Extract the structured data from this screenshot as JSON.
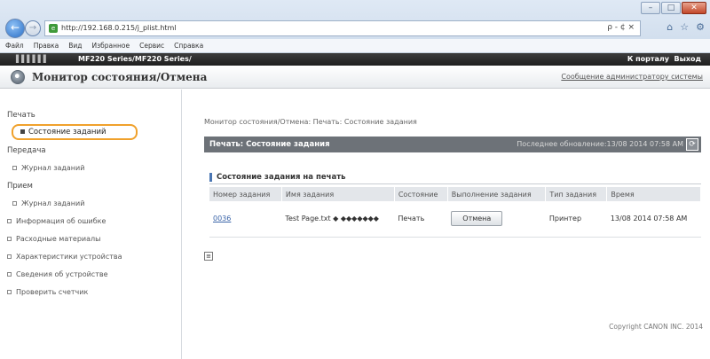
{
  "browser": {
    "url": "http://192.168.0.215/j_plist.html",
    "address_tools": "ρ - ¢ ×",
    "menu": [
      "Файл",
      "Правка",
      "Вид",
      "Избранное",
      "Сервис",
      "Справка"
    ]
  },
  "topbar": {
    "device": "▌▌▌▌▌▌",
    "model": "MF220 Series/MF220 Series/",
    "portal": "К порталу",
    "logout": "Выход"
  },
  "header": {
    "title": "Монитор состояния/Отмена",
    "admin_message": "Сообщение администратору системы"
  },
  "sidebar": {
    "print_section": "Печать",
    "active_item": "Состояние заданий",
    "transfer_section": "Передача",
    "transfer_log": "Журнал заданий",
    "receive_section": "Прием",
    "receive_log": "Журнал заданий",
    "error_info": "Информация об ошибке",
    "consumables": "Расходные материалы",
    "device_features": "Характеристики устройства",
    "device_info": "Сведения об устройстве",
    "check_counter": "Проверить счетчик"
  },
  "main": {
    "breadcrumb": "Монитор состояния/Отмена: Печать: Состояние задания",
    "bar_title": "Печать: Состояние задания",
    "last_update": "Последнее обновление:13/08 2014 07:58 AM",
    "subheading": "Состояние задания на печать",
    "columns": [
      "Номер задания",
      "Имя задания",
      "Состояние",
      "Выполнение задания",
      "Тип задания",
      "Время"
    ],
    "row": {
      "job_number": "0036",
      "job_name": "Test Page.txt ◆ ◆◆◆◆◆◆◆",
      "status": "Печать",
      "action": "Отмена",
      "job_type": "Принтер",
      "time": "13/08 2014 07:58 AM"
    },
    "copyright": "Copyright CANON INC. 2014"
  },
  "colors": {
    "accent_orange": "#f0a12c",
    "bar_gray": "#6d7278",
    "link_blue": "#3a64a8"
  }
}
